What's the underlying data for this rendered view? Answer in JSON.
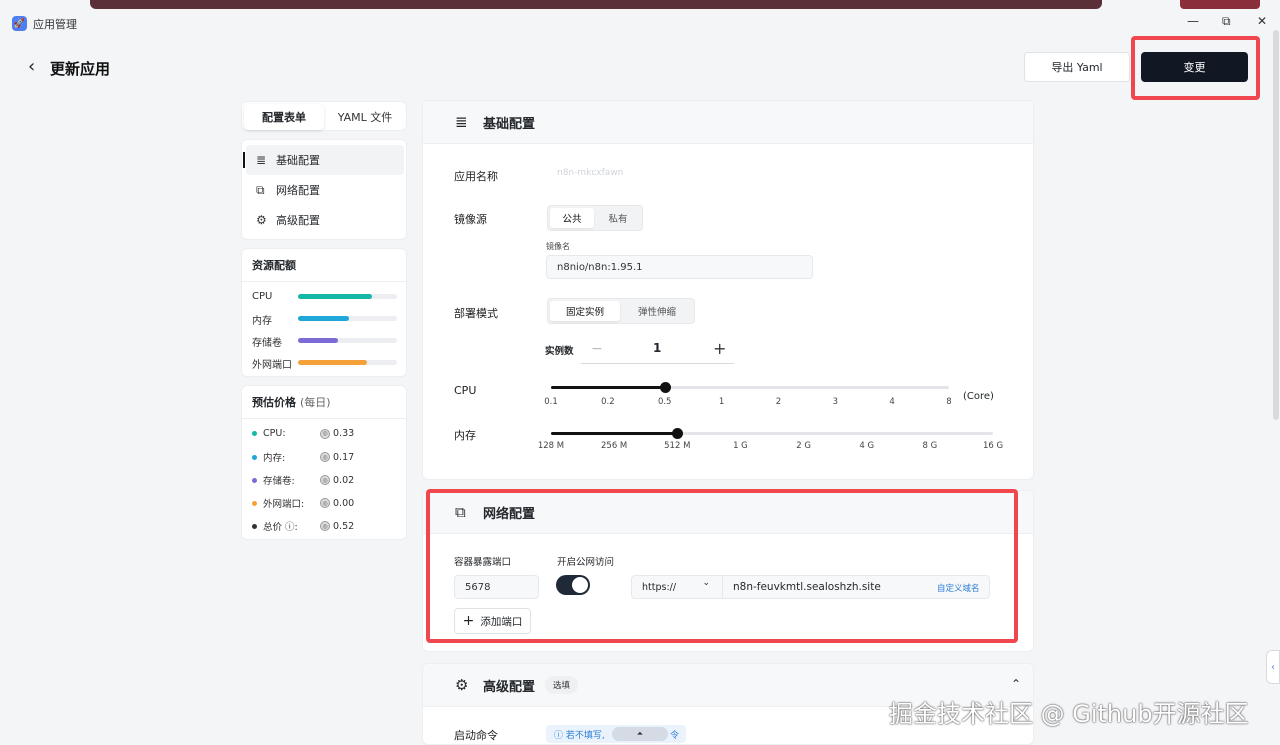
{
  "window": {
    "title": "应用管理",
    "minimize": "—",
    "restore": "⧉",
    "close": "✕"
  },
  "header": {
    "back": "‹",
    "title": "更新应用",
    "export_label": "导出 Yaml",
    "change_label": "变更"
  },
  "tabs": [
    {
      "label": "配置表单",
      "active": true
    },
    {
      "label": "YAML 文件",
      "active": false
    }
  ],
  "nav": [
    {
      "icon": "≣",
      "label": "基础配置",
      "active": true
    },
    {
      "icon": "⧉",
      "label": "网络配置",
      "active": false
    },
    {
      "icon": "⚙",
      "label": "高级配置",
      "active": false
    }
  ],
  "resources": {
    "title": "资源配额",
    "items": [
      {
        "label": "CPU",
        "level": 0.75,
        "color": "#14b8a6"
      },
      {
        "label": "内存",
        "level": 0.52,
        "color": "#1ea7d8"
      },
      {
        "label": "存储卷",
        "level": 0.4,
        "color": "#7c6bd6"
      },
      {
        "label": "外网端口",
        "level": 0.7,
        "color": "#f5a13a"
      }
    ]
  },
  "price": {
    "title": "预估价格",
    "period": "(每日)",
    "items": [
      {
        "label": "CPU:",
        "value": "0.33",
        "color": "#14b8a6"
      },
      {
        "label": "内存:",
        "value": "0.17",
        "color": "#1ea7d8"
      },
      {
        "label": "存储卷:",
        "value": "0.02",
        "color": "#7c6bd6"
      },
      {
        "label": "外网端口:",
        "value": "0.00",
        "color": "#f5a13a"
      },
      {
        "label": "总价 ⓘ:",
        "value": "0.52",
        "color": "#333333"
      }
    ]
  },
  "basic": {
    "title": "基础配置",
    "app_name_label": "应用名称",
    "app_name_value": "n8n-mkcxfawn",
    "image_source_label": "镜像源",
    "image_public": "公共",
    "image_private": "私有",
    "image_name_label": "镜像名",
    "image_name_value": "n8nio/n8n:1.95.1",
    "deploy_mode_label": "部署模式",
    "deploy_fixed": "固定实例",
    "deploy_elastic": "弹性伸缩",
    "instances_label": "实例数",
    "instances_minus": "−",
    "instances_value": "1",
    "instances_plus": "+",
    "cpu_label": "CPU",
    "cpu_unit": "(Core)",
    "cpu_ticks": [
      "0.1",
      "0.2",
      "0.5",
      "1",
      "2",
      "3",
      "4",
      "8"
    ],
    "cpu_selected": "0.5",
    "mem_label": "内存",
    "mem_ticks": [
      "128 M",
      "256 M",
      "512 M",
      "1 G",
      "2 G",
      "4 G",
      "8 G",
      "16 G"
    ],
    "mem_selected": "512 M"
  },
  "network": {
    "title": "网络配置",
    "port_label": "容器暴露端口",
    "port_value": "5678",
    "public_label": "开启公网访问",
    "public_enabled": true,
    "protocol": "https://",
    "protocol_arrow": "⌄",
    "domain": "n8n-feuvkmtl.sealoshzh.site",
    "custom_domain": "自定义域名",
    "add_port": "添加端口",
    "add_icon": "+"
  },
  "advanced": {
    "title": "高级配置",
    "badge": "选填",
    "collapse": "⌃",
    "cmd_label": "启动命令",
    "hint": "ⓘ 若不填写,",
    "hint_tail": "令",
    "scroll_up": "⏶"
  },
  "watermark": "掘金技术社区 @ Github开源社区",
  "side_toggle": "‹"
}
